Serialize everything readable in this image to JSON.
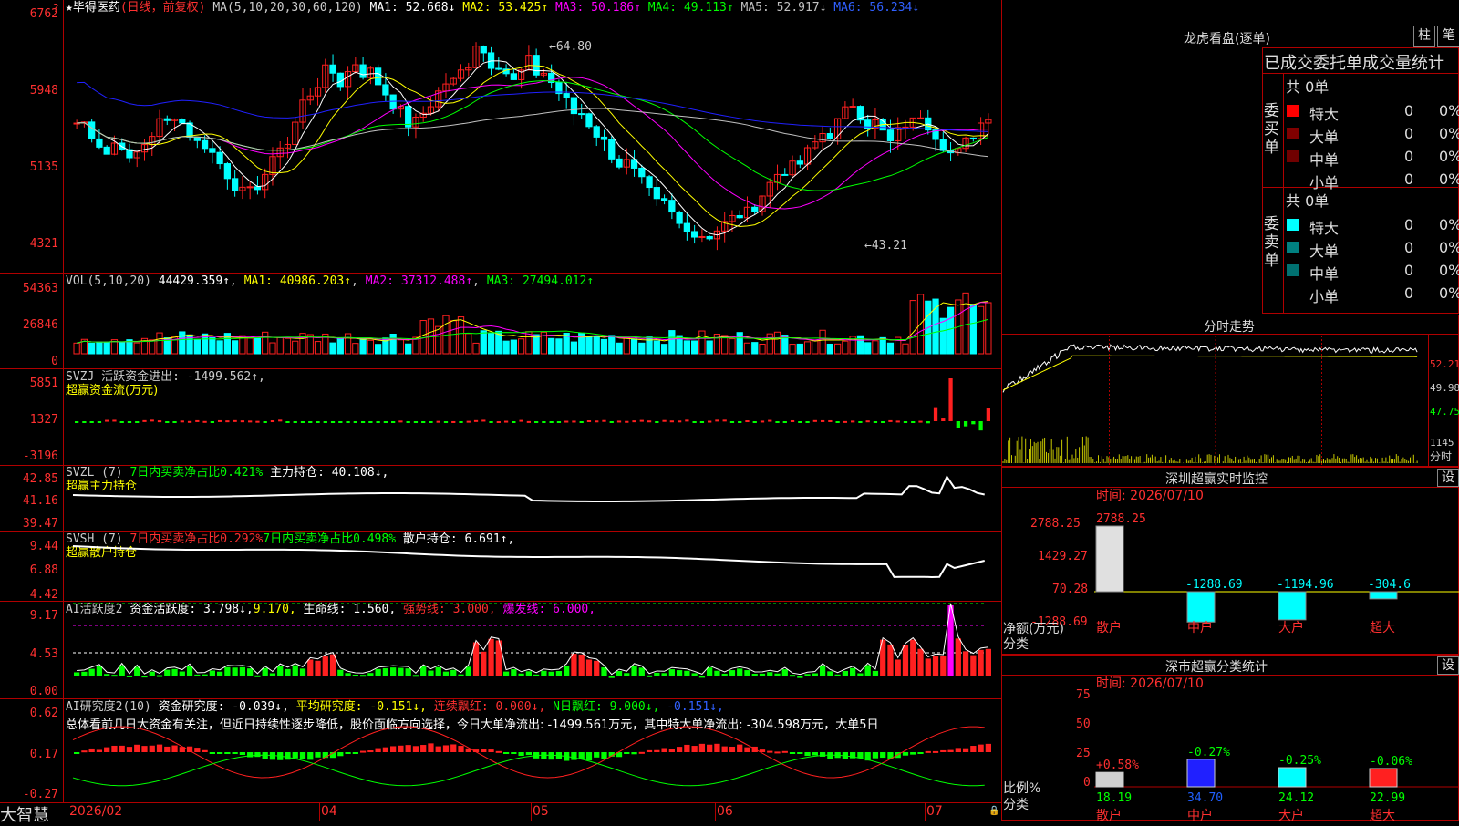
{
  "colors": {
    "up": "#ff2020",
    "down": "#00ffff",
    "ma1": "#ffffff",
    "ma2": "#ffff00",
    "ma3": "#ff00ff",
    "ma4": "#00ff00",
    "ma5": "#c0c0c0",
    "ma6": "#2020ff",
    "green": "#00ff00",
    "grid": "#b00000"
  },
  "kline": {
    "stock_name": "毕得医药",
    "period": "(日线，前复权)",
    "ma_prefix": "MA(5,10,20,30,60,120)",
    "ma1": "MA1: 52.668↓",
    "ma2": "MA2: 53.425↑",
    "ma3": "MA3: 50.186↑",
    "ma4": "MA4: 49.113↑",
    "ma5": "MA5: 52.917↓",
    "ma6": "MA6: 56.234↓",
    "y_ticks": [
      "6762",
      "5948",
      "5135",
      "4321"
    ],
    "high_mark": "64.80",
    "low_mark": "←43.21"
  },
  "vol": {
    "title": "VOL(5,10,20)",
    "value": "44429.359↑",
    "ma1": "MA1: 40986.203↑",
    "ma2": "MA2: 37312.488↑",
    "ma3": "MA3: 27494.012↑",
    "y_ticks": [
      "54363",
      "26846",
      "0"
    ]
  },
  "svzj": {
    "title": "SVZJ  活跃资金进出: -1499.562↑,",
    "sub": "超赢资金流(万元)",
    "y_ticks": [
      "5851",
      "1327",
      "-3196"
    ]
  },
  "svzl": {
    "title": "SVZL (7)",
    "p1": "7日内买卖净占比0.421%",
    "p2": "主力持仓: 40.108↓,",
    "sub": "超赢主力持仓",
    "y_ticks": [
      "42.85",
      "41.16",
      "39.47"
    ]
  },
  "svsh": {
    "title": "SVSH (7)",
    "p1": "7日内买卖净占比0.292%",
    "p2": "7日内买卖净占比0.498%",
    "p3": "散户持仓: 6.691↑,",
    "sub": "超赢散户持仓",
    "y_ticks": [
      "9.44",
      "6.88",
      "4.42"
    ]
  },
  "ai1": {
    "title": "AI活跃度2",
    "p1": "资金活跃度: 3.798↓,",
    "p2": "9.170,",
    "p3": "生命线: 1.560,",
    "p4": "强势线: 3.000,",
    "p5": "爆发线: 6.000,",
    "y_ticks": [
      "9.17",
      "4.53",
      "0.00"
    ]
  },
  "ai2": {
    "title": "AI研究度2(10)",
    "p1": "资金研究度: -0.039↓,",
    "p2": "平均研究度: -0.151↓,",
    "p3": "连续飘红: 0.000↓,",
    "p4": "N日飘红: 9.000↓,",
    "p5": "-0.151↓,",
    "desc": "总体看前几日大资金有关注，但近日持续性逐步降低，股价面临方向选择，今日大单净流出: -1499.561万元，其中特大单净流出: -304.598万元，大单5日",
    "y_ticks": [
      "0.62",
      "0.17",
      "-0.27"
    ]
  },
  "xaxis": {
    "labels": [
      "2026/02",
      "04",
      "05",
      "06",
      "07"
    ]
  },
  "brand": "大智慧",
  "lhb": {
    "title": "龙虎看盘(逐单)",
    "btn1": "柱",
    "btn2": "笔",
    "section_title": "已成交委托单成交量统计",
    "buy_label": "委买单",
    "sell_label": "委卖单",
    "buy_total": "共 0单",
    "sell_total": "共 0单",
    "rows": [
      {
        "name": "特大",
        "count": "0",
        "pct": "0%"
      },
      {
        "name": "大单",
        "count": "0",
        "pct": "0%"
      },
      {
        "name": "中单",
        "count": "0",
        "pct": "0%"
      },
      {
        "name": "小单",
        "count": "0",
        "pct": "0%"
      }
    ]
  },
  "fenshi": {
    "title": "分时走势",
    "y_ticks": [
      "52.21",
      "49.98",
      "47.75"
    ],
    "vol_label": "1145",
    "axis_label": "分时"
  },
  "monitor": {
    "title": "深圳超赢实时监控",
    "btn": "设",
    "time": "时间: 2026/07/10",
    "y_ticks": [
      "2788.25",
      "1429.27",
      "70.28",
      "-1288.69"
    ],
    "ylabel1": "净额(万元)",
    "ylabel2": "分类",
    "cats": [
      "散户",
      "中户",
      "大户",
      "超大"
    ],
    "values": [
      2788.25,
      -1288.69,
      -1194.96,
      -304.6
    ],
    "value_labels": [
      "2788.25",
      "-1288.69",
      "-1194.96",
      "-304.6"
    ]
  },
  "classify": {
    "title": "深市超赢分类统计",
    "btn": "设",
    "time": "时间: 2026/07/10",
    "y_ticks": [
      "75",
      "50",
      "25",
      "0"
    ],
    "ylabel1": "比例%",
    "ylabel2": "分类",
    "cats": [
      "散户",
      "中户",
      "大户",
      "超大"
    ],
    "values": [
      18.19,
      34.7,
      24.12,
      22.99
    ],
    "top_labels": [
      "+0.58%",
      "-0.27%",
      "-0.25%",
      "-0.06%"
    ],
    "bottom_labels": [
      "18.19",
      "34.70",
      "24.12",
      "22.99"
    ]
  }
}
